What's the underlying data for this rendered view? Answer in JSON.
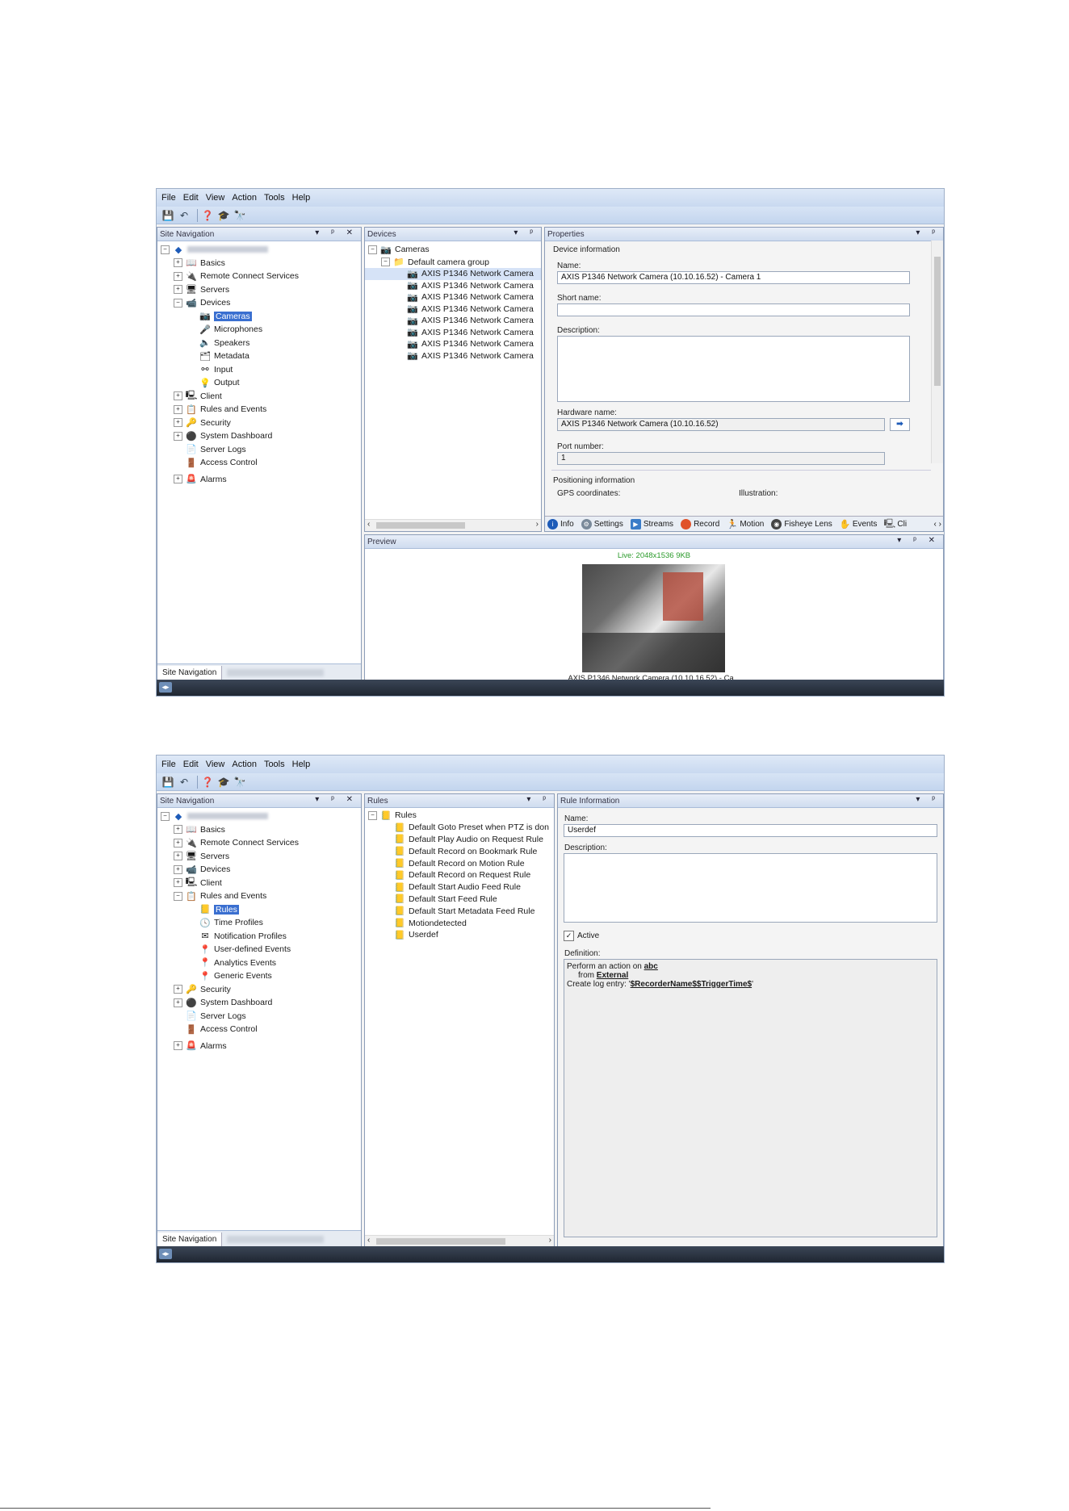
{
  "menu": [
    "File",
    "Edit",
    "View",
    "Action",
    "Tools",
    "Help"
  ],
  "panel_controls": "▾ ᵖ ✕",
  "screen1": {
    "site_nav": {
      "title": "Site Navigation",
      "items": [
        "Basics",
        "Remote Connect Services",
        "Servers",
        "Devices",
        "Cameras",
        "Microphones",
        "Speakers",
        "Metadata",
        "Input",
        "Output",
        "Client",
        "Rules and Events",
        "Security",
        "System Dashboard",
        "Server Logs",
        "Access Control",
        "Alarms"
      ],
      "bottom_tab": "Site Navigation"
    },
    "devices": {
      "title": "Devices",
      "root": "Cameras",
      "group": "Default camera group",
      "cameras": [
        "AXIS P1346 Network Camera",
        "AXIS P1346 Network Camera",
        "AXIS P1346 Network Camera",
        "AXIS P1346 Network Camera",
        "AXIS P1346 Network Camera",
        "AXIS P1346 Network Camera",
        "AXIS P1346 Network Camera",
        "AXIS P1346 Network Camera"
      ]
    },
    "properties": {
      "title": "Properties",
      "section": "Device information",
      "name_label": "Name:",
      "name_value": "AXIS P1346 Network Camera (10.10.16.52) - Camera 1",
      "short_name_label": "Short name:",
      "description_label": "Description:",
      "hardware_label": "Hardware name:",
      "hardware_value": "AXIS P1346 Network Camera (10.10.16.52)",
      "port_label": "Port number:",
      "port_value": "1",
      "positioning": "Positioning information",
      "gps": "GPS coordinates:",
      "illustration": "Illustration:",
      "tabs": [
        "Info",
        "Settings",
        "Streams",
        "Record",
        "Motion",
        "Fisheye Lens",
        "Events",
        "Cli"
      ]
    },
    "preview": {
      "title": "Preview",
      "live": "Live: 2048x1536 9KB",
      "caption": "AXIS P1346 Network Camera (10.10.16.52) - Ca..."
    }
  },
  "screen2": {
    "site_nav": {
      "title": "Site Navigation",
      "items": [
        "Basics",
        "Remote Connect Services",
        "Servers",
        "Devices",
        "Client",
        "Rules and Events",
        "Rules",
        "Time Profiles",
        "Notification Profiles",
        "User-defined Events",
        "Analytics Events",
        "Generic Events",
        "Security",
        "System Dashboard",
        "Server Logs",
        "Access Control",
        "Alarms"
      ],
      "bottom_tab": "Site Navigation"
    },
    "rules": {
      "title": "Rules",
      "root": "Rules",
      "items": [
        "Default Goto Preset when PTZ is don",
        "Default Play Audio on Request Rule",
        "Default Record on Bookmark Rule",
        "Default Record on Motion Rule",
        "Default Record on Request Rule",
        "Default Start Audio Feed Rule",
        "Default Start Feed Rule",
        "Default Start Metadata Feed Rule",
        "Motiondetected",
        "Userdef"
      ]
    },
    "rule_info": {
      "title": "Rule Information",
      "name_label": "Name:",
      "name_value": "Userdef",
      "description_label": "Description:",
      "active_label": "Active",
      "definition_label": "Definition:",
      "def_line1_prefix": "Perform an action on ",
      "def_line1_link": "abc",
      "def_line2_prefix": "from ",
      "def_line2_link": "External",
      "def_line3_prefix": "Create log entry: '",
      "def_line3_link": "$RecorderName$$TriggerTime$",
      "def_line3_suffix": "'"
    }
  },
  "colors": {
    "accent": "#3a6fd0",
    "status_bar": "#1f2631",
    "menu_bg": "#c9d9f0"
  }
}
